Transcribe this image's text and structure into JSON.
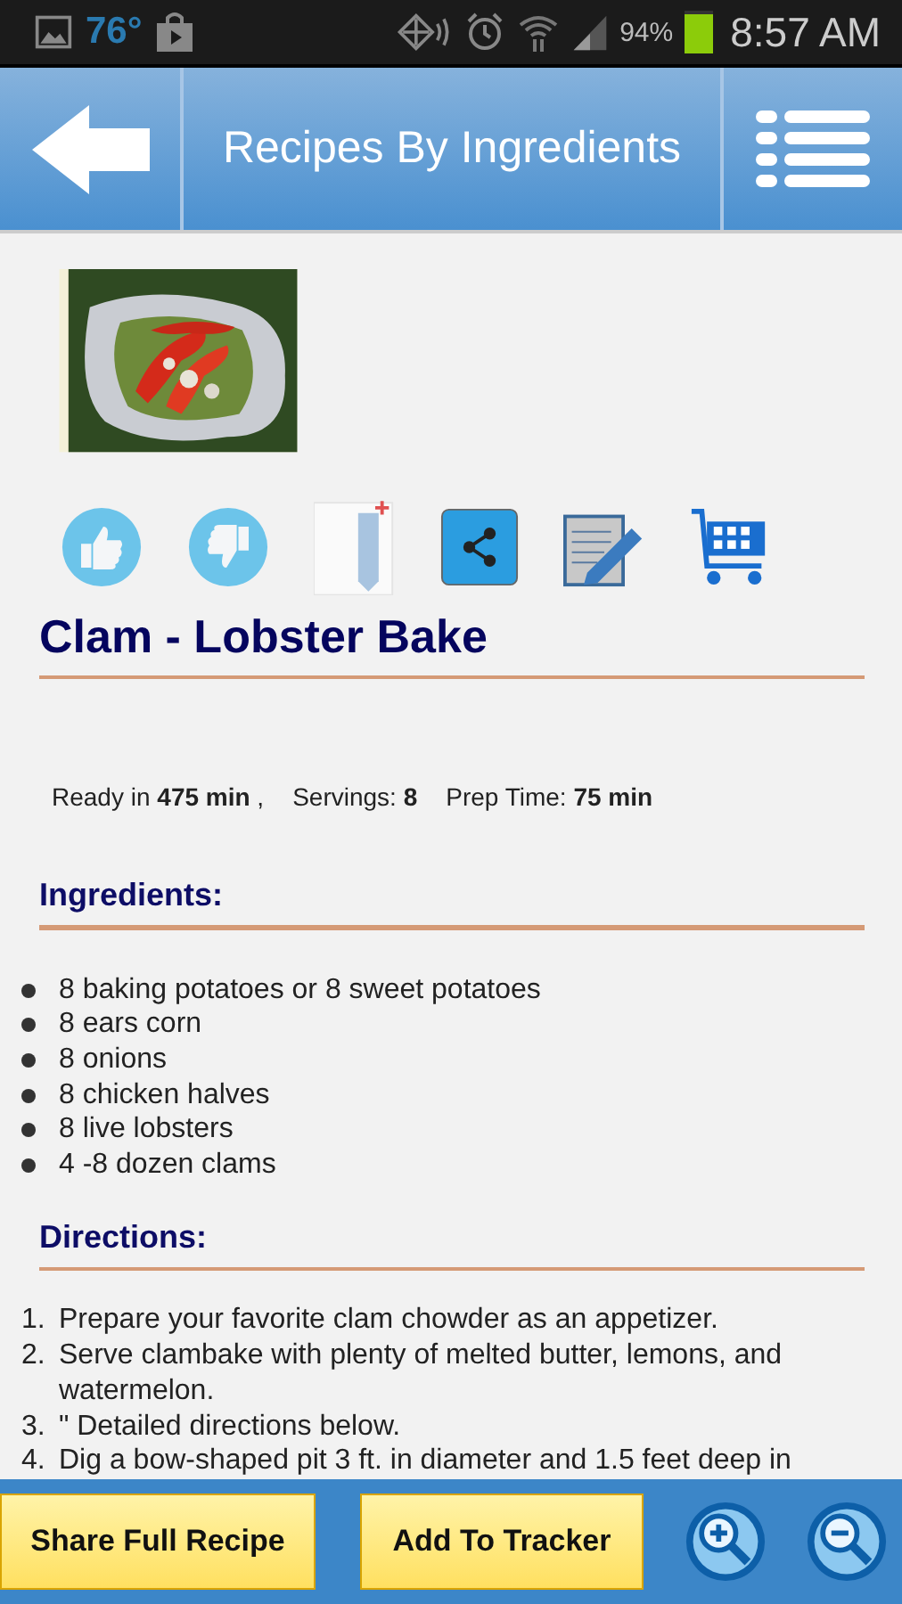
{
  "status_bar": {
    "temperature": "76°",
    "battery_percent": "94%",
    "time": "8:57 AM"
  },
  "header": {
    "title": "Recipes By Ingredients"
  },
  "recipe": {
    "image": {
      "kind": "picture"
    },
    "title": "Clam - Lobster Bake",
    "meta": [
      "Ready in **475 min** ,",
      "Servings: **8**",
      "Prep Time: **75 min**"
    ],
    "ingredients_heading": "Ingredients:",
    "ingredients": [
      "8 baking potatoes or 8 sweet potatoes",
      "8 ears corn",
      "8 onions",
      "8 chicken halves",
      "8 live lobsters",
      "4 -8 dozen clams"
    ],
    "directions_heading": "Directions:",
    "directions": [
      {
        "number": "1.",
        "text": "Prepare your favorite clam chowder as an appetizer."
      },
      {
        "number": "2.",
        "text": "Serve clambake with plenty of melted butter, lemons, and watermelon."
      },
      {
        "number": "3.",
        "text": "\" Detailed directions below."
      },
      {
        "number": "4.",
        "text": "Dig a bow-shaped pit 3 ft. in diameter and 1.5 feet deep in"
      }
    ]
  },
  "footer": {
    "buttons": [
      "Share Full Recipe",
      "Add To Tracker"
    ]
  }
}
